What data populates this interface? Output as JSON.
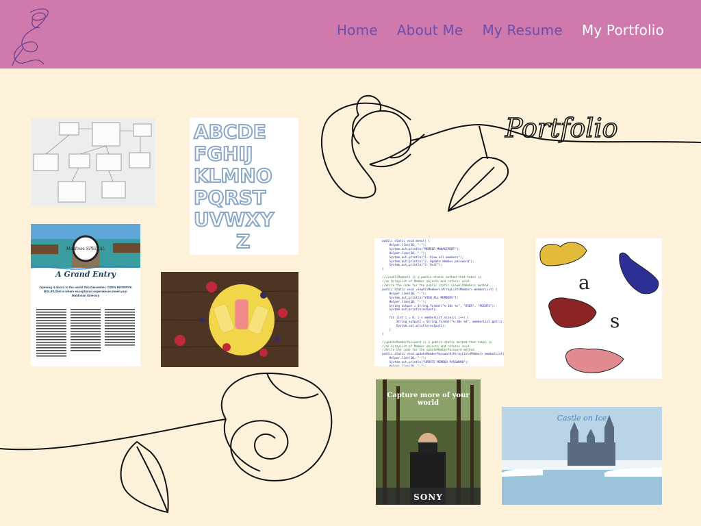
{
  "nav": {
    "items": [
      {
        "label": "Home",
        "active": false
      },
      {
        "label": "About Me",
        "active": false
      },
      {
        "label": "My Resume",
        "active": false
      },
      {
        "label": "My Portfolio",
        "active": true
      }
    ]
  },
  "hero": {
    "script_title": "Portfolio"
  },
  "thumbnails": {
    "flyer": {
      "badge": "Maldives SPECIAL",
      "title": "A Grand Entry",
      "subtitle": "Opening it doors to the world this December, OZEN RESERVE BOLIFUSHI is where exceptional experiences meet your Maldivian itinerary"
    },
    "code": {
      "lines": [
        "  public static void menu() {",
        "      Helper.line(30, \"-\");",
        "      System.out.println(\"MEMBER MANAGEMENT\");",
        "      Helper.line(30, \"-\");",
        "      System.out.println(\"1. View all members\");",
        "      System.out.println(\"2. Update member password\");",
        "      System.out.println(\"3. Quit\");",
        "  }",
        "",
        "  //viewAllMembers is a public static method that takes in",
        "  //an ArrayList of Member objects and returns void.",
        "  //Write the code for the public static viewAllMembers method.",
        "  public static void viewAllMembers(ArrayList<Member> memberList) {",
        "      Helper.line(30, \"-\");",
        "      System.out.println(\"VIEW ALL MEMBERS\");",
        "      Helper.line(30, \"-\");",
        "      String output = String.format(\"%-10s %s\", \"USER\", \"POINTS\");",
        "      System.out.println(output);",
        "",
        "      for (int i = 0; i < memberList.size(); i++) {",
        "          String output1 = String.format(\"%-10s %d\", memberList.get(i).get",
        "          System.out.println(output1);",
        "      }",
        "  }",
        "",
        "  //updateMemberPassword is a public static method that takes in",
        "  //an ArrayList of Member objects and returns void.",
        "  //Write the code for the updateMemberPassword method.",
        "  public static void updateMemberPassword(ArrayList<Member> memberList) {",
        "      Helper.line(30, \"-\");",
        "      System.out.println(\"UPDATE MEMBER PASSWORD\");",
        "      Helper.line(30, \"-\");"
      ]
    },
    "butterfly": {
      "letter_a": "a",
      "letter_s": "s"
    },
    "sony": {
      "headline": "Capture more of your world",
      "brand": "SONY"
    },
    "castle": {
      "title": "Castle on Ice"
    }
  },
  "colors": {
    "header_bg": "#cf79ac",
    "page_bg": "#fdf1da",
    "nav_text": "#6a4ea8",
    "nav_active": "#ffffff"
  }
}
